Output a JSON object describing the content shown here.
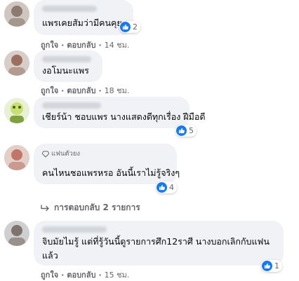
{
  "comments": [
    {
      "text": "แพรเคยสัมว่ามีคนคุย",
      "reaction_count": "2",
      "like_label": "ถูกใจ",
      "reply_label": "ตอบกลับ",
      "time": "14 ชม."
    },
    {
      "text": "งอโมนะแพร",
      "like_label": "ถูกใจ",
      "reply_label": "ตอบกลับ",
      "time": "18 ชม."
    },
    {
      "text": "เชียร์น้า ชอบแพร นางแสดงดีทุกเรื่อง ฝีมือดี",
      "reaction_count": "5",
      "like_label": "ถูกใจ",
      "reply_label": "ตอบกลับ",
      "time": "18 ชม."
    },
    {
      "badge": "แฟนตัวยง",
      "text": "คนไหนชอแพรหรอ อันนี้เราไม่รู้จริงๆ",
      "reaction_count": "4",
      "like_label": "ถูกใจ",
      "reply_label": "ตอบกลับ",
      "time": "18 ชม."
    },
    {
      "text": "จิบมัยไมรู้ แต่ที่รู้วันนี้ดูรายการศึก12ราศี นางบอกเลิกกับแฟน แล้ว",
      "reaction_count": "1",
      "like_label": "ถูกใจ",
      "reply_label": "ตอบกลับ",
      "time": "15 ชม."
    }
  ],
  "view_replies_label": "การตอบกลับ 2 รายการ",
  "colors": {
    "bubble": "#f0f2f5",
    "like_blue": "#1877f2",
    "meta_text": "#65676b",
    "body_text": "#050505"
  },
  "icons": {
    "like": "thumbs-up-icon",
    "badge": "diamond-icon",
    "reply_arrow": "reply-arrow-icon"
  }
}
